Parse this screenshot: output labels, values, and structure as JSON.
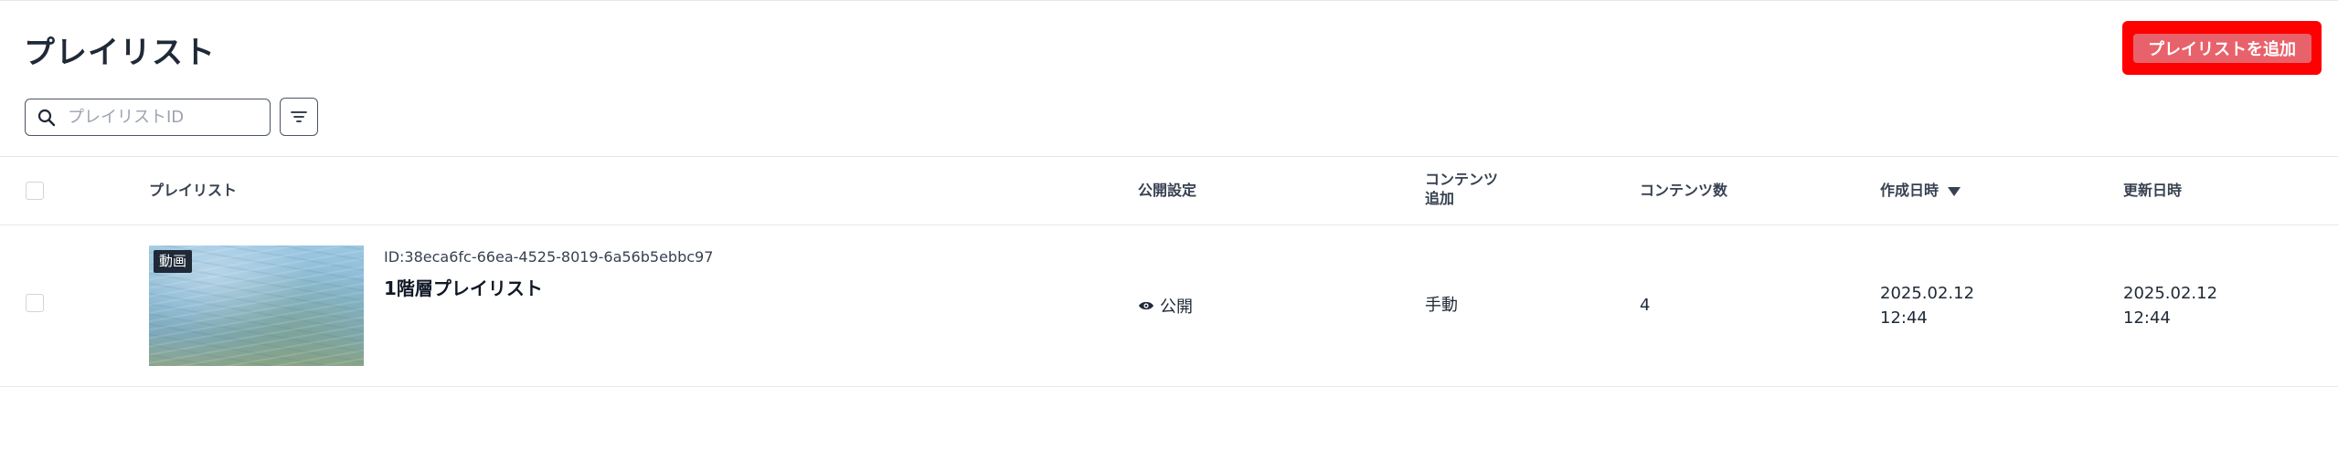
{
  "page": {
    "title": "プレイリスト",
    "add_button_label": "プレイリストを追加"
  },
  "search": {
    "placeholder": "プレイリストID",
    "value": ""
  },
  "icons": {
    "search": "search-icon",
    "filter": "filter-icon",
    "sort": "sort-desc-icon",
    "visibility": "eye-icon"
  },
  "colors": {
    "accent_button": "#e8626b",
    "highlight_frame": "#ff0000"
  },
  "table": {
    "headers": {
      "playlist": "プレイリスト",
      "visibility": "公開設定",
      "content_add_line1": "コンテンツ",
      "content_add_line2": "追加",
      "content_count": "コンテンツ数",
      "created": "作成日時",
      "updated": "更新日時"
    },
    "sort": {
      "column": "作成日時",
      "direction": "desc"
    },
    "rows": [
      {
        "badge": "動画",
        "id": "ID:38eca6fc-66ea-4525-8019-6a56b5ebbc97",
        "name": "1階層プレイリスト",
        "visibility": "公開",
        "content_add": "手動",
        "content_count": "4",
        "created_date": "2025.02.12",
        "created_time": "12:44",
        "updated_date": "2025.02.12",
        "updated_time": "12:44"
      }
    ]
  }
}
